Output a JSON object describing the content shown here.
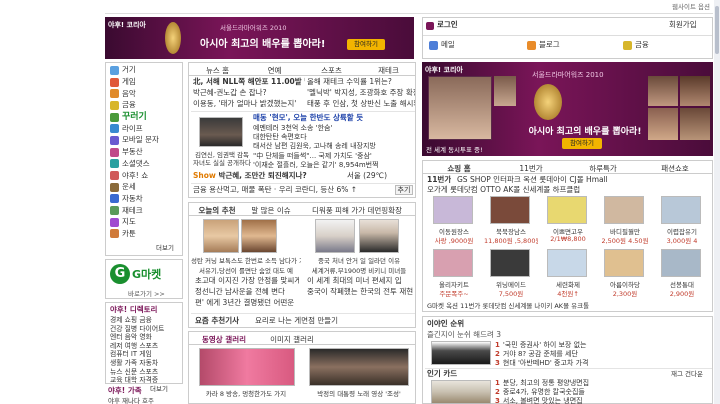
{
  "top_link": "웹사이트 옵션",
  "banner_left": {
    "brand": "야후! 코리아",
    "event": "서울드라마어워즈 2010",
    "headline": "아시아 최고의 배우를 뽑아라!",
    "button": "참여하기"
  },
  "banner_right": {
    "brand": "야후! 코리아",
    "event": "서울드라마어워즈 2010",
    "headline": "아시아 최고의 배우를 뽑아라!",
    "button": "참여하기",
    "footer": "전 세계 동시투표 중!"
  },
  "login": {
    "label": "로그인",
    "signup": "회원가입",
    "mail": "메일",
    "blog": "블로그",
    "finance": "금융"
  },
  "sidebar": {
    "items": [
      "게임",
      "음악",
      "금융",
      "꾸러기",
      "라이프",
      "모바일 문자",
      "부동산",
      "소셜댓스",
      "야후! 쇼",
      "운세",
      "자동차",
      "재테크",
      "지도",
      "카툰"
    ],
    "first": "거기",
    "more": "더보기"
  },
  "gmarket": {
    "name": "G마켓",
    "sub": "바로가기 >>"
  },
  "directory": {
    "title": "야후! 디렉토리",
    "rows": [
      "경제 쇼핑 금융",
      "건강 질병 다이어트",
      "엔터 음악 영화",
      "레저 여행 스포츠",
      "컴퓨터 IT 게임",
      "생활 가족 자동차",
      "뉴스 신문 스포츠",
      "교육 대학 자격증"
    ],
    "more": "더보기"
  },
  "family": {
    "title": "야후! 가족",
    "items": "야후 재나다 호주"
  },
  "news": {
    "tabs": [
      "뉴스 홈",
      "연예",
      "스포츠",
      "재테크"
    ],
    "headlines": [
      "北, 서해 NLL쪽 해안포 11.00발 발사",
      "올해 재테크 수익률 1위는?",
      "박근혜-권노갑 손 잡나?",
      "'멜닉박' 박지성, 조광화호 주장 확정",
      "이용동, '태가 얼마나 밝겠했는지'",
      "태풍 후 인삼, 첫 상반신 노출 해시확보"
    ],
    "feature": "매동 '현모', 오늘 한반도 상륙할 듯",
    "feature_lines": [
      "예멘테러 3천억 소송 '한숨'",
      "대한탄탄 속편호다",
      "태서산 남편 김원욱, 고나해 송레 내장지방",
      "\"中 단체들 떠들썩\"... 국제 가치도 '중삼'",
      "'이재순 절흘러, 오늘은 같기' 8,954m번쩍"
    ],
    "photo_caption": [
      "김연신, 임권택 감독",
      "자녀도 실실 공개하다"
    ],
    "show_line": "박근혜, 조만간 퇴진해지나?",
    "weather": "서울 (29℃)",
    "finance_line": "금융 용산먹고, 매물 폭탄 · 우리 코란디, 등산 6% ↑",
    "more_btn": "추기"
  },
  "today": {
    "tabs": [
      "오늘의 추천",
      "말 많은 이슈",
      "디워풍 피해 가가 데먼핑확장"
    ],
    "cap1": [
      "성탄 커닝 보톡스도 한번로 소득 남다가 거가도 봐",
      "서유기,당선이 를면단 숨었 대도 예"
    ],
    "cap2": [
      "중국 처녀 안거 일 일라던 이유",
      "세계거류,부1900명 비키니 미녀들"
    ],
    "lines": [
      "초고대 이지진 가장 안정를 맞씨게",
      "정선니간 남사운을 전혜 변다",
      "편' 에게 3년간 결명됐던 어떤운"
    ],
    "lines2": [
      "이 세계 최대의 미너 편세지 입",
      "중국이 작폐했는 한국의 전투 재현"
    ],
    "footer": "요즘 추천기사",
    "footer2": "요리로 나는 게면점 만들기"
  },
  "video": {
    "tabs": [
      "동영상 갤러리",
      "이미지 갤러리"
    ],
    "cap1": "카라 8 방송, 멍청한가도 가지",
    "cap2": "박정의 대통령 노래 영상 '조성'"
  },
  "shopping": {
    "tabs": [
      "쇼핑 홈",
      "11번가",
      "하루특가",
      "패션쇼호"
    ],
    "row_label": "11번가",
    "links": "GS SHOP 인터파크 옥션 롯데아이 CJ몰 Hmall",
    "links2": "오가게 롯데닷컴 OTTO AK몰 신세계몰 하프클럽",
    "items1": [
      "이동원장스",
      "북북장남스",
      "이쁘면고우",
      "바디필뭘만",
      "이렵잡유기"
    ],
    "prices1": [
      "사랑 ,9000원",
      "11,800원 ,5,800원",
      "2/1₩8,800",
      "2,500원 4.50원",
      "3,000원 4"
    ],
    "items2": [
      "올리자키트",
      "위닝메이드",
      "세련화제",
      "아름이하당",
      "선봉통대"
    ],
    "prices2": [
      "주문폭주~",
      "7,500원",
      "4천원↑",
      "2,300원",
      "2,900원"
    ],
    "bottom": "G마켓 옥션 11번가 롯데닷컴 신세계몰 나이키 AK몰 유크톨"
  },
  "popular": {
    "title": "이야인 순위",
    "sub": "즐긴지이 눈쉬 해드려 3",
    "items": [
      "'국민 증권사' 하이 보장 없는",
      "거야 8? 공감 준체를 세단",
      "현대 '아반떼HD' 중고차 가격"
    ]
  },
  "hot": {
    "title": "인기 카드",
    "more": "재그 건다운",
    "items": [
      "분당, 최고의 정통 평양냉면집",
      "중로4가, 유명한 칼국숫집들",
      "서소, 볼벼면 맛있는 냉면집"
    ]
  }
}
